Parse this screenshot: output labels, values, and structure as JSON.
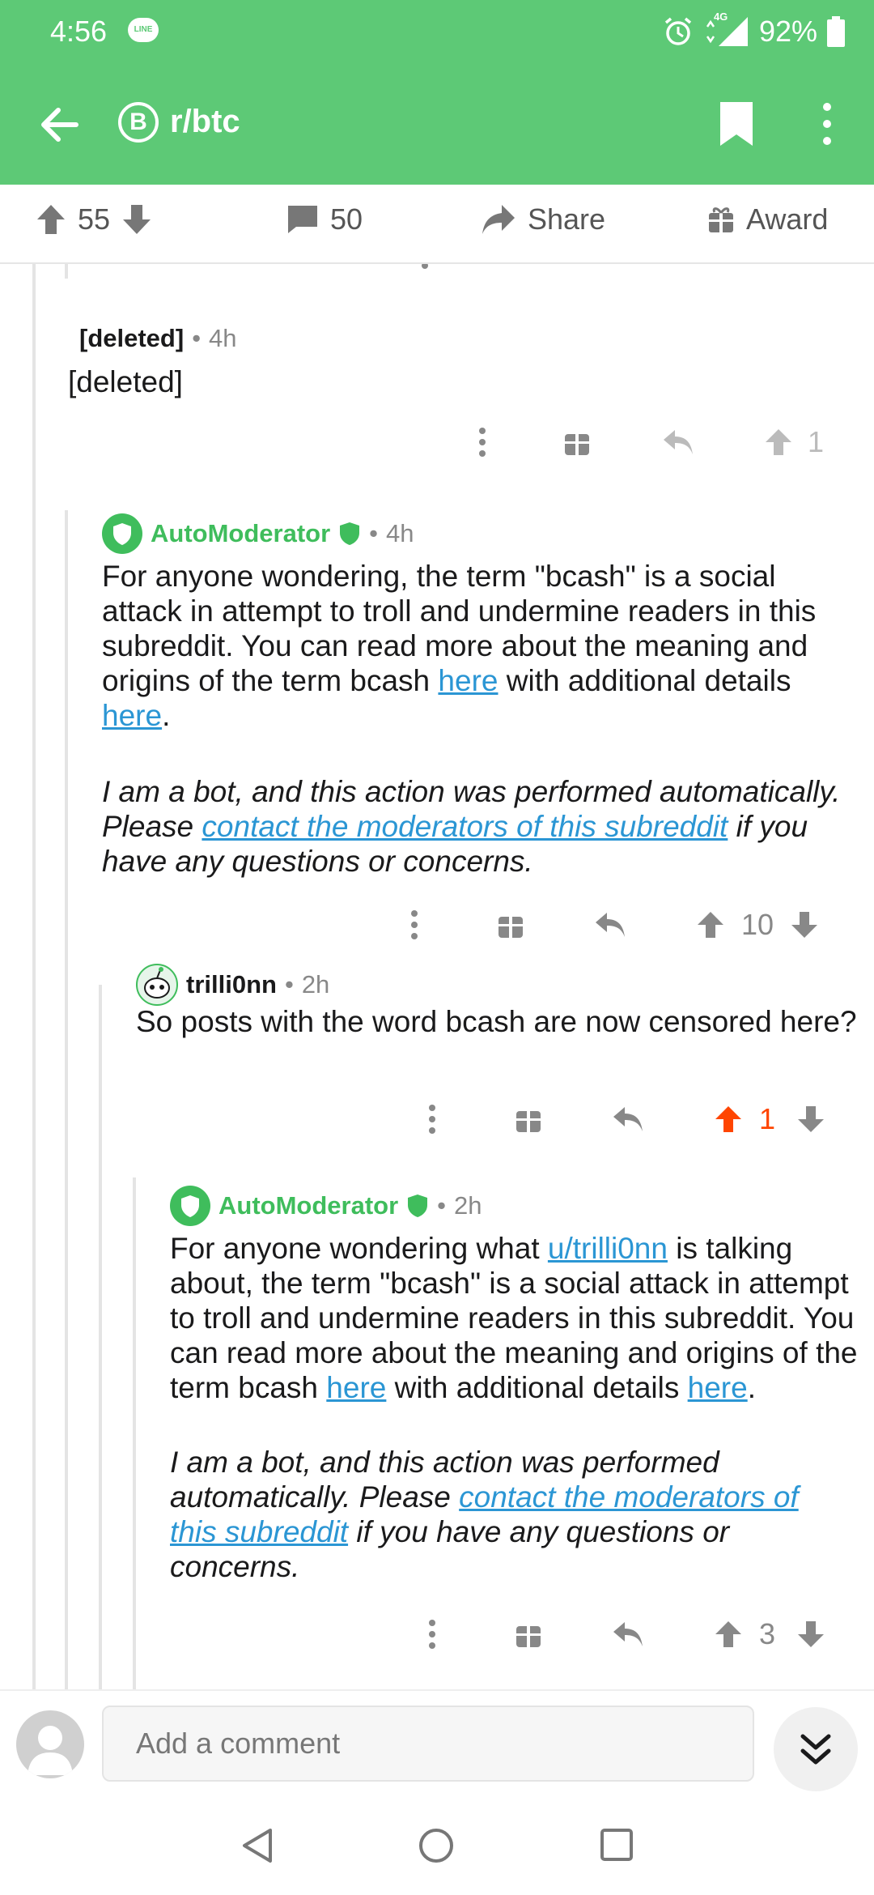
{
  "status": {
    "time": "4:56",
    "line_badge": "LINE",
    "network": "4G",
    "battery": "92%"
  },
  "header": {
    "subreddit": "r/btc",
    "sub_icon_letter": "B"
  },
  "post_actions": {
    "upvotes": "55",
    "comments": "50",
    "share": "Share",
    "award": "Award"
  },
  "comments": [
    {
      "author": "[deleted]",
      "sep": "•",
      "time": "4h",
      "body": "[deleted]",
      "score": "1"
    },
    {
      "author": "AutoModerator",
      "sep": "•",
      "time": "4h",
      "body_parts": [
        "For anyone wondering, the term \"bcash\" is a social attack in attempt to troll and undermine readers in this subreddit. You can read more about the meaning and origins of the term bcash ",
        "here",
        " with additional details ",
        "here",
        "."
      ],
      "bot_parts": [
        "I am a bot, and this action was performed automatically. Please ",
        "contact the moderators of this subreddit",
        " if you have any questions or concerns."
      ],
      "score": "10"
    },
    {
      "author": "trilli0nn",
      "sep": "•",
      "time": "2h",
      "body": "So posts with the word bcash are now censored here?",
      "score": "1"
    },
    {
      "author": "AutoModerator",
      "sep": "•",
      "time": "2h",
      "body_parts": [
        "For anyone wondering what ",
        "u/trilli0nn",
        " is talking about, the term \"bcash\" is a social attack in attempt to troll and undermine readers in this subreddit. You can read more about the meaning and origins of the term bcash ",
        "here",
        " with additional details ",
        "here",
        "."
      ],
      "bot_parts": [
        "I am a bot, and this action was performed automatically. Please ",
        "contact the moderators of this subreddit",
        " if you have any questions or concerns."
      ],
      "score": "3"
    }
  ],
  "comment_bar": {
    "placeholder": "Add a comment"
  },
  "colors": {
    "brand_green": "#5dc976",
    "mod_green": "#3fbd5c",
    "upvote_orange": "#ff4500",
    "link_blue": "#2b96d4"
  }
}
